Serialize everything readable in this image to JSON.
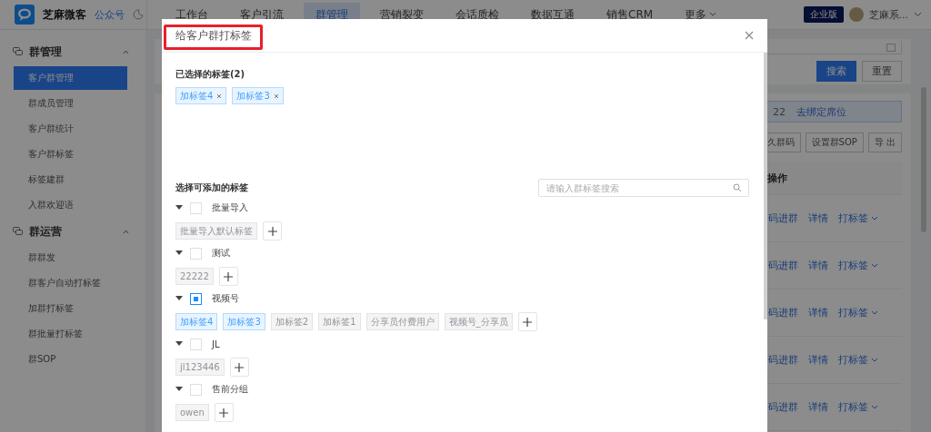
{
  "header": {
    "logo_text": "芝麻微客",
    "account_link": "公众号",
    "nav": [
      {
        "label": "工作台",
        "selected": false
      },
      {
        "label": "客户引流",
        "selected": false
      },
      {
        "label": "群管理",
        "selected": true
      },
      {
        "label": "营销裂变",
        "selected": false
      },
      {
        "label": "会话质检",
        "selected": false
      },
      {
        "label": "数据互通",
        "selected": false
      },
      {
        "label": "销售CRM",
        "selected": false
      },
      {
        "label": "更多",
        "selected": false
      }
    ],
    "edition_badge": "企业版",
    "user_name": "芝麻系..."
  },
  "sidebar": {
    "sections": [
      {
        "title": "群管理",
        "expanded": true,
        "items": [
          {
            "label": "客户群管理",
            "selected": true
          },
          {
            "label": "群成员管理",
            "selected": false
          },
          {
            "label": "客户群统计",
            "selected": false
          },
          {
            "label": "客户群标签",
            "selected": false
          },
          {
            "label": "标签建群",
            "selected": false
          },
          {
            "label": "入群欢迎语",
            "selected": false
          }
        ]
      },
      {
        "title": "群运营",
        "expanded": true,
        "items": [
          {
            "label": "群群发",
            "selected": false
          },
          {
            "label": "群客户自动打标签",
            "selected": false
          },
          {
            "label": "加群打标签",
            "selected": false
          },
          {
            "label": "群批量打标签",
            "selected": false
          },
          {
            "label": "群SOP",
            "selected": false
          }
        ]
      }
    ]
  },
  "content": {
    "search_button": "搜索",
    "reset_button": "重置",
    "notice": {
      "count": "22",
      "link": "去绑定席位"
    },
    "toolbar_buttons": [
      "久群码",
      "设置群SOP",
      "导 出"
    ],
    "table": {
      "columns": [
        "操作"
      ],
      "rows": [
        {
          "actions": [
            "码进群",
            "详情",
            "打标签"
          ]
        },
        {
          "actions": [
            "码进群",
            "详情",
            "打标签"
          ]
        },
        {
          "actions": [
            "码进群",
            "详情",
            "打标签"
          ]
        },
        {
          "actions": [
            "码进群",
            "详情",
            "打标签"
          ]
        },
        {
          "actions": [
            "码进群",
            "详情",
            "打标签"
          ]
        }
      ]
    }
  },
  "dialog": {
    "title": "给客户群打标签",
    "title_highlighted": true,
    "selected_heading": "已选择的标签(2)",
    "selected_tags": [
      "加标签4",
      "加标签3"
    ],
    "available_heading": "选择可添加的标签",
    "search": {
      "placeholder": "请输入群标签搜索"
    },
    "groups": [
      {
        "name": "批量导入",
        "expanded": true,
        "indeterminate": false,
        "tags": [
          {
            "label": "批量导入默认标签",
            "selected": false
          }
        ]
      },
      {
        "name": "测试",
        "expanded": true,
        "indeterminate": false,
        "tags": [
          {
            "label": "22222",
            "selected": false
          }
        ]
      },
      {
        "name": "视频号",
        "expanded": true,
        "indeterminate": true,
        "tags": [
          {
            "label": "加标签4",
            "selected": true
          },
          {
            "label": "加标签3",
            "selected": true
          },
          {
            "label": "加标签2",
            "selected": false
          },
          {
            "label": "加标签1",
            "selected": false
          },
          {
            "label": "分享员付费用户",
            "selected": false
          },
          {
            "label": "视频号_分享员",
            "selected": false
          }
        ]
      },
      {
        "name": "JL",
        "expanded": true,
        "indeterminate": false,
        "tags": [
          {
            "label": "jl123446",
            "selected": false
          }
        ]
      },
      {
        "name": "售前分组",
        "expanded": true,
        "indeterminate": false,
        "tags": [
          {
            "label": "owen",
            "selected": false
          }
        ]
      }
    ]
  }
}
